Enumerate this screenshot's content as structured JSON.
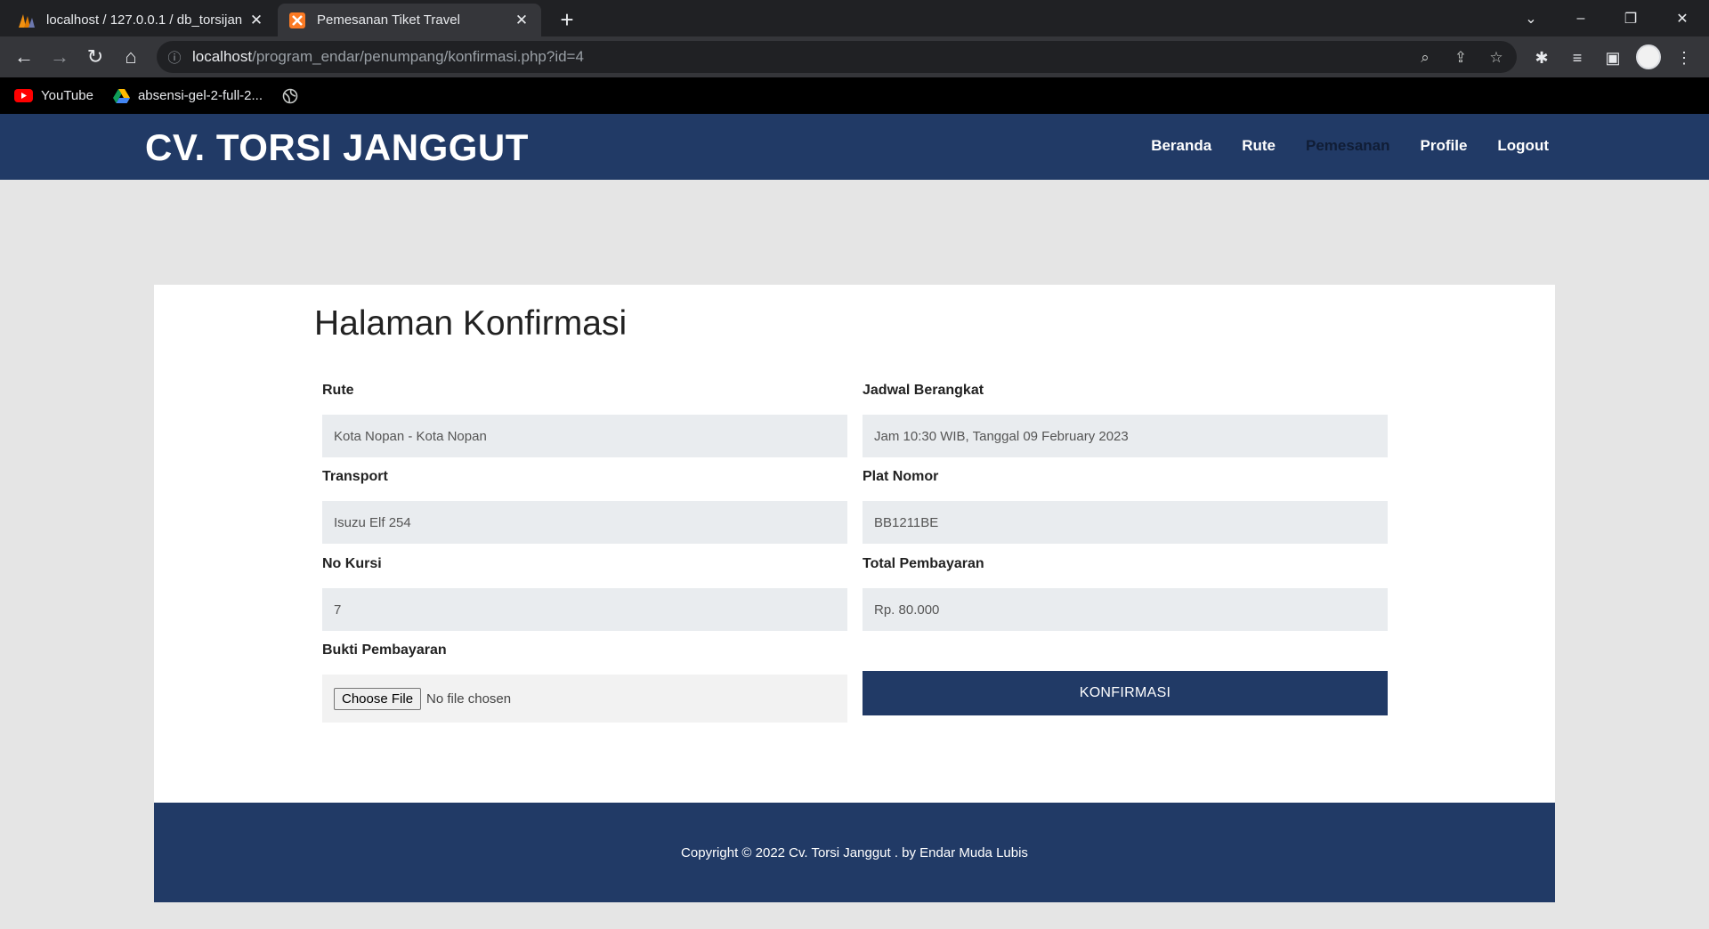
{
  "browser": {
    "tabs": [
      {
        "title": "localhost / 127.0.0.1 / db_torsijan",
        "active": false
      },
      {
        "title": "Pemesanan Tiket Travel",
        "active": true
      }
    ],
    "url": {
      "host": "localhost",
      "path": "/program_endar/penumpang/konfirmasi.php?id=4"
    },
    "bookmarks": [
      {
        "label": "YouTube",
        "icon": "youtube-icon"
      },
      {
        "label": "absensi-gel-2-full-2...",
        "icon": "google-drive-icon"
      },
      {
        "label": "",
        "icon": "globe-icon"
      }
    ]
  },
  "site": {
    "brand": "CV. TORSI JANGGUT",
    "nav": [
      {
        "label": "Beranda"
      },
      {
        "label": "Rute"
      },
      {
        "label": "Pemesanan",
        "current": true
      },
      {
        "label": "Profile"
      },
      {
        "label": "Logout"
      }
    ]
  },
  "form": {
    "title": "Halaman Konfirmasi",
    "rute": {
      "label": "Rute",
      "value": "Kota Nopan - Kota Nopan"
    },
    "jadwal": {
      "label": "Jadwal Berangkat",
      "value": "Jam 10:30 WIB, Tanggal 09 February 2023"
    },
    "transport": {
      "label": "Transport",
      "value": "Isuzu Elf 254"
    },
    "plat": {
      "label": "Plat Nomor",
      "value": "BB1211BE"
    },
    "kursi": {
      "label": "No Kursi",
      "value": "7"
    },
    "total": {
      "label": "Total Pembayaran",
      "value": "Rp. 80.000"
    },
    "bukti": {
      "label": "Bukti Pembayaran",
      "button": "Choose File",
      "status": "No file chosen"
    },
    "submit": "KONFIRMASI"
  },
  "footer": {
    "text": "Copyright © 2022 Cv. Torsi Janggut . by Endar Muda Lubis"
  },
  "colors": {
    "brand_navy": "#213a66",
    "page_bg": "#e5e5e5",
    "input_bg": "#e9ecef"
  }
}
